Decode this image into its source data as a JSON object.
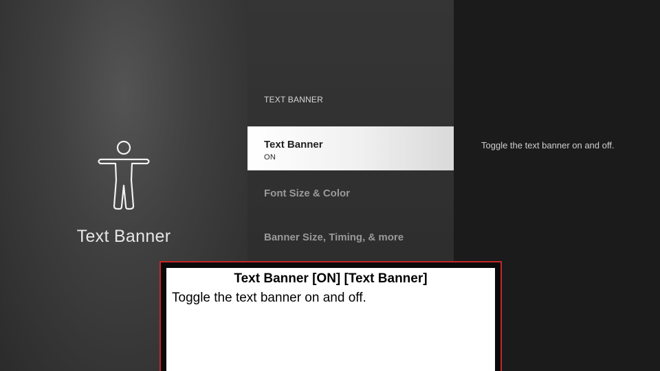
{
  "left_panel": {
    "icon": "accessibility-person-icon",
    "title": "Text Banner"
  },
  "middle_panel": {
    "section_header": "TEXT BANNER",
    "items": [
      {
        "label": "Text Banner",
        "value": "ON",
        "selected": true
      },
      {
        "label": "Font Size & Color",
        "selected": false
      },
      {
        "label": "Banner Size, Timing, & more",
        "selected": false
      }
    ]
  },
  "right_panel": {
    "description": "Toggle the text banner on and off."
  },
  "text_banner_overlay": {
    "title": "Text Banner [ON] [Text Banner]",
    "body": "Toggle the text banner on and off."
  },
  "colors": {
    "selected_bg": "#ffffff",
    "overlay_border": "#c62828"
  }
}
